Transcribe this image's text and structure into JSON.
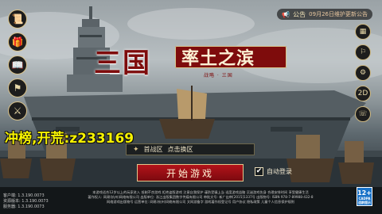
{
  "colors": {
    "accent_red": "#7e0c0c",
    "start_button": "#b3131a",
    "promo_yellow": "#f6f200",
    "gold_border": "#d9c28a"
  },
  "top_banner": {
    "text": "公告",
    "note": "09月26日维护更新公告"
  },
  "left_menu": [
    {
      "name": "announcement-icon",
      "glyph": "📜"
    },
    {
      "name": "gift-icon",
      "glyph": "🎁"
    },
    {
      "name": "book-icon",
      "glyph": "📖"
    },
    {
      "name": "rank-icon",
      "glyph": "⚑"
    },
    {
      "name": "swords-icon",
      "glyph": "⚔"
    }
  ],
  "right_menu": [
    {
      "name": "calendar-icon",
      "glyph": "▦"
    },
    {
      "name": "notice-icon",
      "glyph": "⚐"
    },
    {
      "name": "settings-icon",
      "glyph": "⚙"
    },
    {
      "name": "video-icon",
      "glyph": "2D"
    },
    {
      "name": "phone-icon",
      "glyph": "☏"
    }
  ],
  "logo": {
    "main": "三国",
    "subtitle": "率土之滨",
    "small": "战略 · 三国"
  },
  "promo_text": "冲榜,开荒:z233169",
  "server": {
    "name": "首战区",
    "switch_label": "点击换区"
  },
  "start_button": {
    "label": "开始游戏"
  },
  "auto_login": {
    "label": "自动登录",
    "checked": true
  },
  "footer": {
    "version_lines": [
      "客户端: 1.3.190.0073",
      "资源版本: 1.3.190.0073",
      "服务器: 1.3.190.0073"
    ],
    "legal_lines": [
      "本游戏适合12岁以上的玩家进入 抵制不良游戏 拒绝盗版游戏 注意自我保护 谨防受骗上当 适度游戏益脑 沉迷游戏伤身 合理安排时间 享受健康生活",
      "著作权人: 网易(杭州)网络有限公司 出版单位: 浙江出版集团数字传媒有限公司 审批文号: 新广出审[2015]1337号 出版物号: ISBN 978-7-89988-432-8",
      "网络游戏出版物号 运营单位: 网易(杭州)网络有限公司 文网游备字 游戏著作权登记号 用户协议 隐私政策 儿童个人信息保护规则"
    ]
  },
  "age_rating": {
    "value": "12+",
    "label": "CADPA",
    "note": "适龄提示"
  }
}
